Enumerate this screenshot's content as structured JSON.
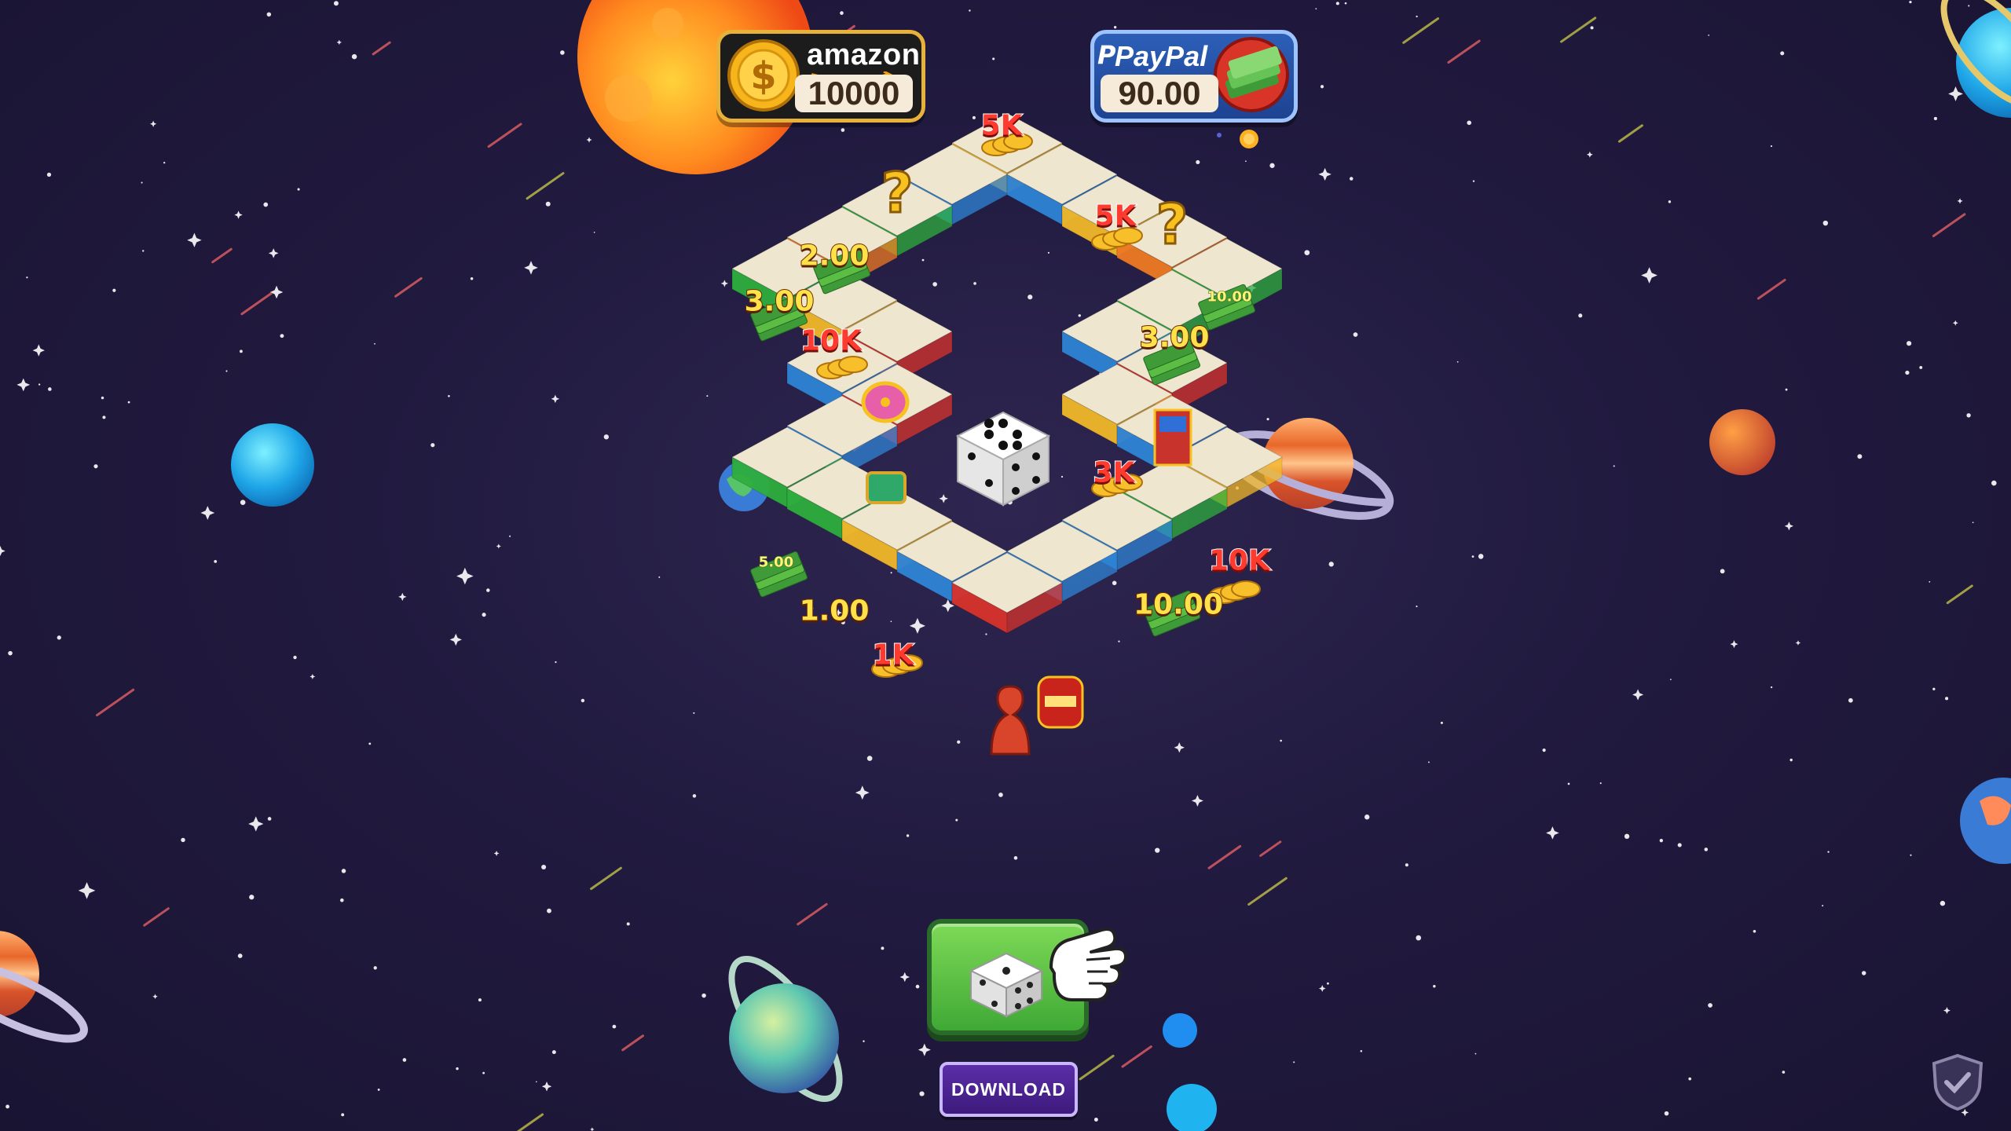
{
  "balances": {
    "amazon": {
      "brand": "amazon",
      "value": "10000",
      "icon": "dollar-coin-icon",
      "accent": "#e8b23a"
    },
    "paypal": {
      "brand": "PayPal",
      "value": "90.00",
      "icon": "cash-stack-icon",
      "accent": "#2d5fb8"
    }
  },
  "board": {
    "tile_labels": [
      {
        "id": "top-5k",
        "text": "5K",
        "kind": "coin"
      },
      {
        "id": "right-5k",
        "text": "5K",
        "kind": "coin"
      },
      {
        "id": "left-2",
        "text": "2.00",
        "kind": "money"
      },
      {
        "id": "left-3",
        "text": "3.00",
        "kind": "money"
      },
      {
        "id": "left-10k",
        "text": "10K",
        "kind": "coin"
      },
      {
        "id": "right-10",
        "text": "10.00",
        "kind": "small"
      },
      {
        "id": "right-3",
        "text": "3.00",
        "kind": "money"
      },
      {
        "id": "mid-3k",
        "text": "3K",
        "kind": "coin"
      },
      {
        "id": "bottom-left-5",
        "text": "5.00",
        "kind": "small"
      },
      {
        "id": "bottom-left-1",
        "text": "1.00",
        "kind": "money"
      },
      {
        "id": "bottom-1k",
        "text": "1K",
        "kind": "coin"
      },
      {
        "id": "bottom-right-10k",
        "text": "10K",
        "kind": "coin"
      },
      {
        "id": "bottom-right-10",
        "text": "10.00",
        "kind": "money"
      }
    ],
    "icons": [
      "question-mark-icon",
      "lucky-wheel-icon",
      "treasure-chest-icon",
      "gift-tower-icon",
      "slot-machine-icon",
      "pawn-icon",
      "dice-icon"
    ]
  },
  "controls": {
    "roll_icon": "dice-icon",
    "hint_icon": "pointing-hand-icon",
    "download_label": "DOWNLOAD"
  },
  "colors": {
    "background": "#211a3f",
    "tile_top": "#efe6cf",
    "tile_green": "#2fae3e",
    "tile_yellow": "#f2b82a",
    "tile_blue": "#2f84d6",
    "tile_red": "#d8332c",
    "tile_orange": "#ef7a24",
    "button_green": "#5cc443",
    "download_purple": "#4a2391"
  }
}
